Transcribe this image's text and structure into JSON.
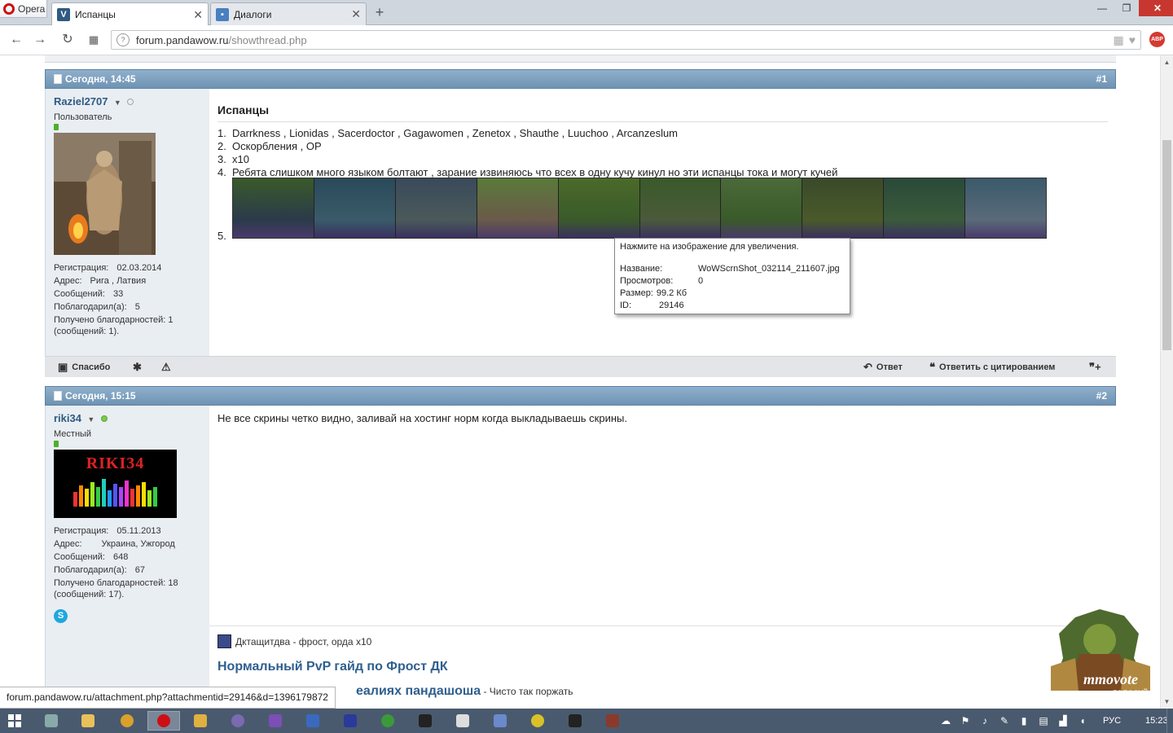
{
  "browser": {
    "app_name": "Opera",
    "tabs": [
      {
        "label": "Испанцы",
        "active": true
      },
      {
        "label": "Диалоги",
        "active": false
      }
    ],
    "new_tab": "+",
    "url_host": "forum.pandawow.ru",
    "url_path": "/showthread.php",
    "abp_label": "ABP"
  },
  "posts": [
    {
      "date": "Сегодня, 14:45",
      "number": "#1",
      "user": {
        "name": "Raziel2707",
        "title": "Пользователь",
        "status": "offline",
        "details": [
          {
            "k": "Регистрация:",
            "v": "02.03.2014"
          },
          {
            "k": "Адрес:",
            "v": "Рига , Латвия"
          },
          {
            "k": "Сообщений:",
            "v": "33"
          },
          {
            "k": "Поблагодарил(а):",
            "v": "5"
          }
        ],
        "thanks_line1": "Получено благодарностей: 1",
        "thanks_line2": "(сообщений: 1)."
      },
      "title": "Испанцы",
      "list": [
        {
          "n": "1.",
          "t": "Darrkness , Lionidas , Sacerdoctor , Gagawomen , Zenetox , Shauthe , Luuchoo , Arcanzeslum"
        },
        {
          "n": "2.",
          "t": "Оскорбления , OP"
        },
        {
          "n": "3.",
          "t": "x10"
        },
        {
          "n": "4.",
          "t": "Ребята слишком много языком болтают , зарание извиняюсь что всех в одну кучу кинул но эти испанцы тока и могут кучей"
        },
        {
          "n": "5.",
          "t": ""
        }
      ],
      "footer": {
        "thanks": "Спасибо",
        "reply": "Ответ",
        "quote": "Ответить с цитированием"
      }
    },
    {
      "date": "Сегодня, 15:15",
      "number": "#2",
      "user": {
        "name": "riki34",
        "title": "Местный",
        "status": "online",
        "avatar_text": "RIKI34",
        "details": [
          {
            "k": "Регистрация:",
            "v": "05.11.2013"
          },
          {
            "k": "Адрес:",
            "v": "Украина, Ужгород"
          },
          {
            "k": "Сообщений:",
            "v": "648"
          },
          {
            "k": "Поблагодарил(а):",
            "v": "67"
          }
        ],
        "thanks_line1": "Получено благодарностей: 18",
        "thanks_line2": "(сообщений: 17)."
      },
      "text": "Не все скрины четко видно, заливай на хостинг норм когда выкладываешь скрины.",
      "signature": {
        "line1": "Дктащитдва - фрост, орда x10",
        "link1": "Нормальный PvP гайд по Фрост ДК",
        "link2_partial": "еалиях пандашоша",
        "link2_suffix": " - Чисто так поржать"
      }
    }
  ],
  "tooltip": {
    "head": "Нажмите на изображение для увеличения.",
    "rows": [
      {
        "k": "Название:",
        "v": "WoWScrnShot_032114_211607.jpg"
      },
      {
        "k": "Просмотров:",
        "v": "0"
      },
      {
        "k": "Размер:",
        "v": "99.2 Кб"
      },
      {
        "k": "ID:",
        "v": "29146"
      }
    ]
  },
  "status_url": "forum.pandawow.ru/attachment.php?attachmentid=29146&d=1396179872",
  "mmovote": {
    "line1": "mmovote",
    "line2": "ГОЛОСУЙ"
  },
  "taskbar": {
    "lang": "РУС",
    "time": "15:23"
  },
  "colors": {
    "post_header": "#7a9cbb",
    "username": "#2f5a82",
    "userinfo_bg": "#e9eef3",
    "taskbar": "#4a5a6e"
  }
}
